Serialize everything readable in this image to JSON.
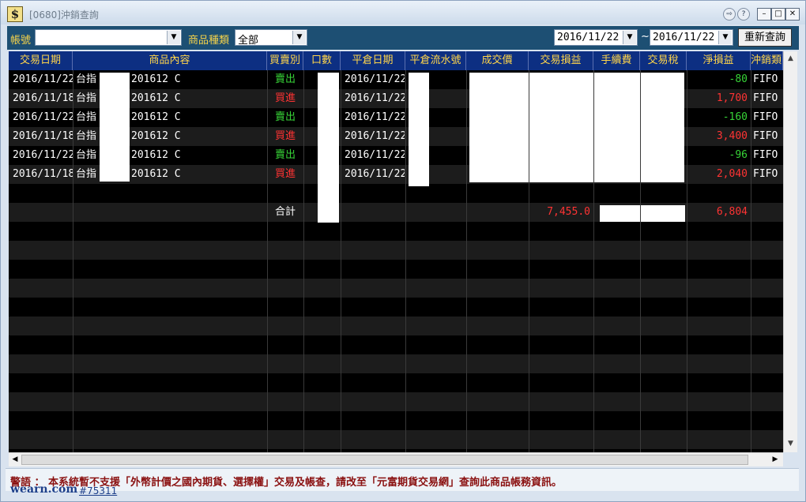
{
  "window": {
    "title": "[0680]沖銷查詢",
    "app_icon_glyph": "$"
  },
  "title_buttons": {
    "forward": "⇨",
    "help": "?",
    "minimize": "–",
    "maximize": "□",
    "close": "✕"
  },
  "toolbar": {
    "account_label": "帳號",
    "account_value": "",
    "product_type_label": "商品種類",
    "product_type_value": "全部",
    "date_from": "2016/11/22",
    "date_sep": "~",
    "date_to": "2016/11/22",
    "requery_label": "重新查詢"
  },
  "columns": [
    "交易日期",
    "商品內容",
    "買賣別",
    "口數",
    "平倉日期",
    "平倉流水號",
    "成交價",
    "交易損益",
    "手續費",
    "交易稅",
    "淨損益",
    "沖銷類"
  ],
  "rows": [
    {
      "trade_date": "2016/11/22",
      "product_prefix": "台指",
      "product_suffix": "201612 C",
      "side": "賣出",
      "side_color": "#37d437",
      "close_date": "2016/11/22",
      "net_pnl": "-80",
      "net_color": "#37d437",
      "method": "FIFO"
    },
    {
      "trade_date": "2016/11/18",
      "product_prefix": "台指",
      "product_suffix": "201612 C",
      "side": "買進",
      "side_color": "#ff3333",
      "close_date": "2016/11/22",
      "net_pnl": "1,700",
      "net_color": "#ff3333",
      "method": "FIFO"
    },
    {
      "trade_date": "2016/11/22",
      "product_prefix": "台指",
      "product_suffix": "201612 C",
      "side": "賣出",
      "side_color": "#37d437",
      "close_date": "2016/11/22",
      "net_pnl": "-160",
      "net_color": "#37d437",
      "method": "FIFO"
    },
    {
      "trade_date": "2016/11/18",
      "product_prefix": "台指",
      "product_suffix": "201612 C",
      "side": "買進",
      "side_color": "#ff3333",
      "close_date": "2016/11/22",
      "net_pnl": "3,400",
      "net_color": "#ff3333",
      "method": "FIFO"
    },
    {
      "trade_date": "2016/11/22",
      "product_prefix": "台指",
      "product_suffix": "201612 C",
      "side": "賣出",
      "side_color": "#37d437",
      "close_date": "2016/11/22",
      "net_pnl": "-96",
      "net_color": "#37d437",
      "method": "FIFO"
    },
    {
      "trade_date": "2016/11/18",
      "product_prefix": "台指",
      "product_suffix": "201612 C",
      "side": "買進",
      "side_color": "#ff3333",
      "close_date": "2016/11/22",
      "net_pnl": "2,040",
      "net_color": "#ff3333",
      "method": "FIFO"
    }
  ],
  "summary": {
    "label": "合計",
    "trade_pnl": "7,455.0",
    "net_pnl": "6,804"
  },
  "warning": "警語 ： 本系統暫不支援「外幣計價之國內期貨、選擇權」交易及帳查，請改至「元富期貨交易網」查詢此商品帳務資訊。",
  "watermark": {
    "brand": "wearn.com",
    "id": "#75311"
  },
  "colors": {
    "header_bg": "#0d2f82",
    "header_text": "#ffd54a",
    "toolbar_bg": "#1d4f73",
    "buy": "#ff3333",
    "sell": "#37d437"
  }
}
